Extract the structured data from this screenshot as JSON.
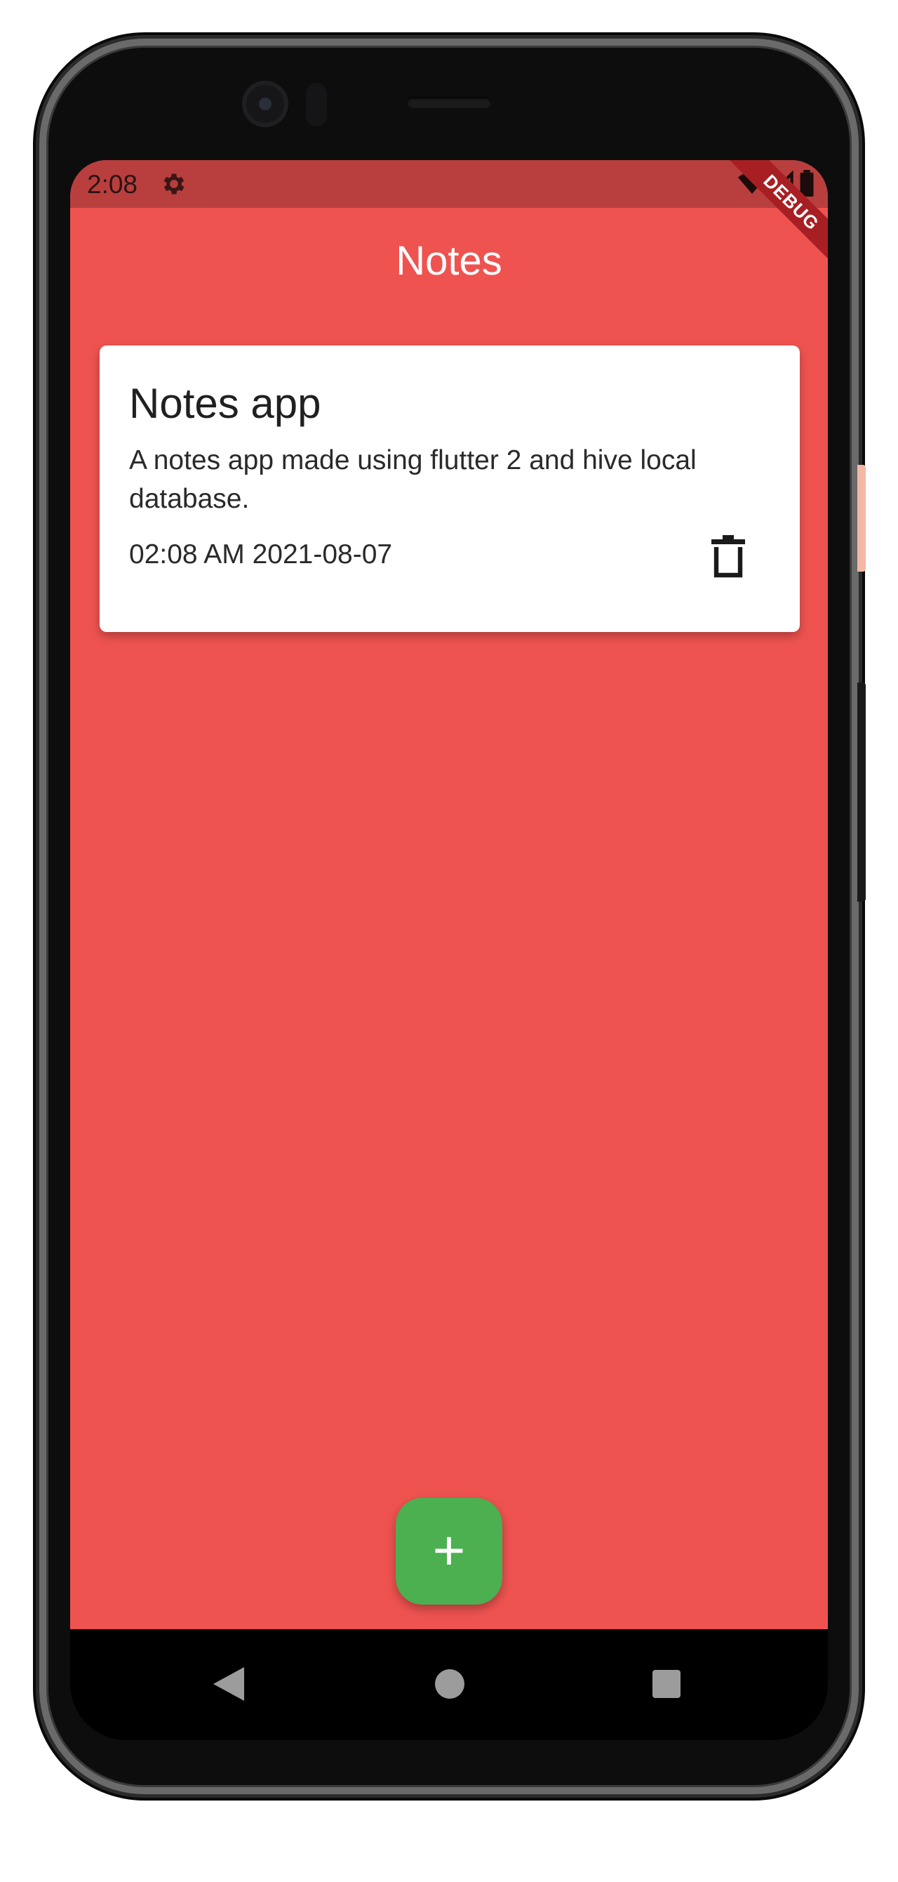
{
  "status_bar": {
    "time": "2:08",
    "settings_icon": "gear-icon",
    "wifi_icon": "wifi-icon",
    "signal_icon": "signal-icon",
    "battery_icon": "battery-icon",
    "debug_label": "DEBUG"
  },
  "app_bar": {
    "title": "Notes"
  },
  "notes": [
    {
      "title": "Notes app",
      "body": "A notes app made using flutter 2 and hive local database.",
      "timestamp": "02:08 AM 2021-08-07",
      "delete_icon": "trash-icon"
    }
  ],
  "fab": {
    "label": "+",
    "icon": "plus-icon",
    "color": "#4caf50"
  },
  "navigation": {
    "back_icon": "back-icon",
    "home_icon": "home-icon",
    "recents_icon": "recents-icon"
  },
  "colors": {
    "background": "#ef5350",
    "status_bar": "#b83f3d",
    "card": "#ffffff",
    "debug_banner": "#a81f23"
  }
}
